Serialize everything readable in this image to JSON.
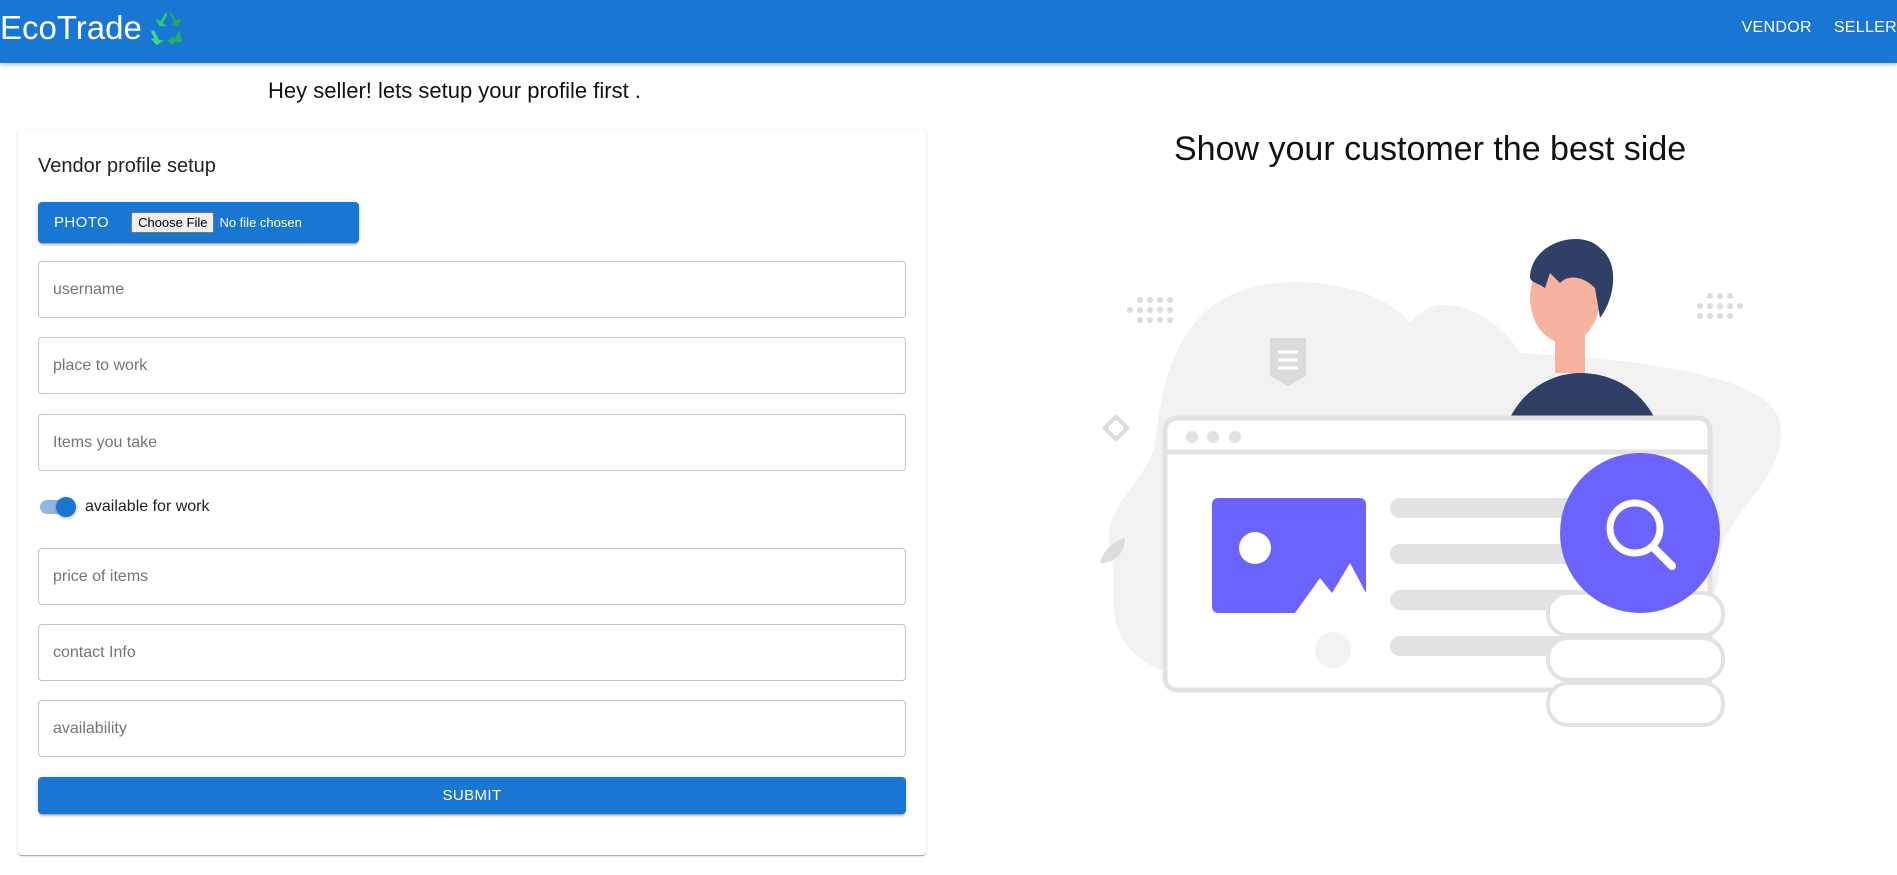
{
  "app": {
    "brand": "EcoTrade",
    "logo_icon": "recycle-icon"
  },
  "nav": {
    "items": [
      {
        "label": "VENDOR"
      },
      {
        "label": "SELLER"
      }
    ]
  },
  "intro": "Hey seller! lets setup your profile first .",
  "form": {
    "title": "Vendor profile setup",
    "photo": {
      "label": "PHOTO",
      "choose": "Choose File",
      "status": "No file chosen"
    },
    "fields": {
      "username": {
        "placeholder": "username"
      },
      "place": {
        "placeholder": "place to work"
      },
      "items": {
        "placeholder": "Items you take"
      },
      "price": {
        "placeholder": "price of items"
      },
      "contact": {
        "placeholder": "contact Info"
      },
      "availability": {
        "placeholder": "availability"
      }
    },
    "toggle": {
      "label": "available for work",
      "checked": true
    },
    "submit": "SUBMIT"
  },
  "right": {
    "title": "Show your customer the best side"
  },
  "colors": {
    "primary": "#1976d2",
    "accent_purple": "#6c63ff",
    "dark_navy": "#2f3f65"
  }
}
